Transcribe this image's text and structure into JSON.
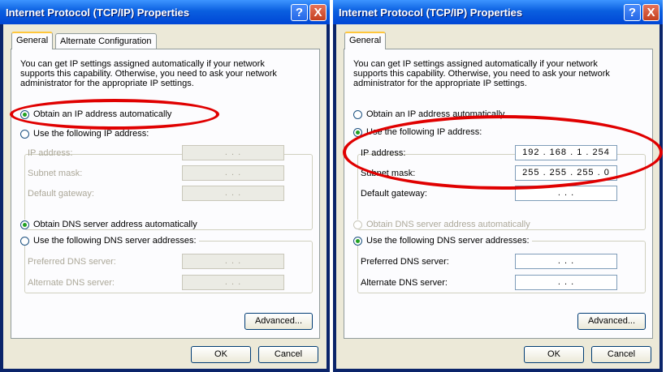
{
  "windows": [
    {
      "title": "Internet Protocol (TCP/IP) Properties",
      "help_label": "?",
      "close_label": "X",
      "tabs": [
        "General",
        "Alternate Configuration"
      ],
      "intro": "You can get IP settings assigned automatically if your network supports this capability. Otherwise, you need to ask your network administrator for the appropriate IP settings.",
      "obtain_ip_auto": "Obtain an IP address automatically",
      "use_following_ip": "Use the following IP address:",
      "ip_address_label": "IP address:",
      "subnet_mask_label": "Subnet mask:",
      "default_gateway_label": "Default gateway:",
      "ip_address_value": ". . .",
      "subnet_mask_value": ". . .",
      "default_gateway_value": ". . .",
      "obtain_dns_auto": "Obtain DNS server address automatically",
      "use_following_dns": "Use the following DNS server addresses:",
      "preferred_dns_label": "Preferred DNS server:",
      "alternate_dns_label": "Alternate DNS server:",
      "preferred_dns_value": ". . .",
      "alternate_dns_value": ". . .",
      "advanced_label": "Advanced...",
      "ok_label": "OK",
      "cancel_label": "Cancel"
    },
    {
      "title": "Internet Protocol (TCP/IP) Properties",
      "help_label": "?",
      "close_label": "X",
      "tabs": [
        "General"
      ],
      "intro": "You can get IP settings assigned automatically if your network supports this capability. Otherwise, you need to ask your network administrator for the appropriate IP settings.",
      "obtain_ip_auto": "Obtain an IP address automatically",
      "use_following_ip": "Use the following IP address:",
      "ip_address_label": "IP address:",
      "subnet_mask_label": "Subnet mask:",
      "default_gateway_label": "Default gateway:",
      "ip_address_value": "192 . 168 . 1 . 254",
      "subnet_mask_value": "255 . 255 . 255 . 0",
      "default_gateway_value": ". . .",
      "obtain_dns_auto": "Obtain DNS server address automatically",
      "use_following_dns": "Use the following DNS server addresses:",
      "preferred_dns_label": "Preferred DNS server:",
      "alternate_dns_label": "Alternate DNS server:",
      "preferred_dns_value": ". . .",
      "alternate_dns_value": ". . .",
      "advanced_label": "Advanced...",
      "ok_label": "OK",
      "cancel_label": "Cancel"
    }
  ],
  "state": {
    "left": {
      "ip_mode": "auto",
      "dns_mode": "auto"
    },
    "right": {
      "ip_mode": "manual",
      "dns_mode": "manual"
    }
  },
  "colors": {
    "title_gradient_top": "#3d95ff",
    "title_gradient_bottom": "#0046d5",
    "dialog_bg": "#ece9d8",
    "page_bg": "#fcfcfe",
    "highlight_ellipse": "#e00000",
    "radio_selected": "#21a121"
  }
}
